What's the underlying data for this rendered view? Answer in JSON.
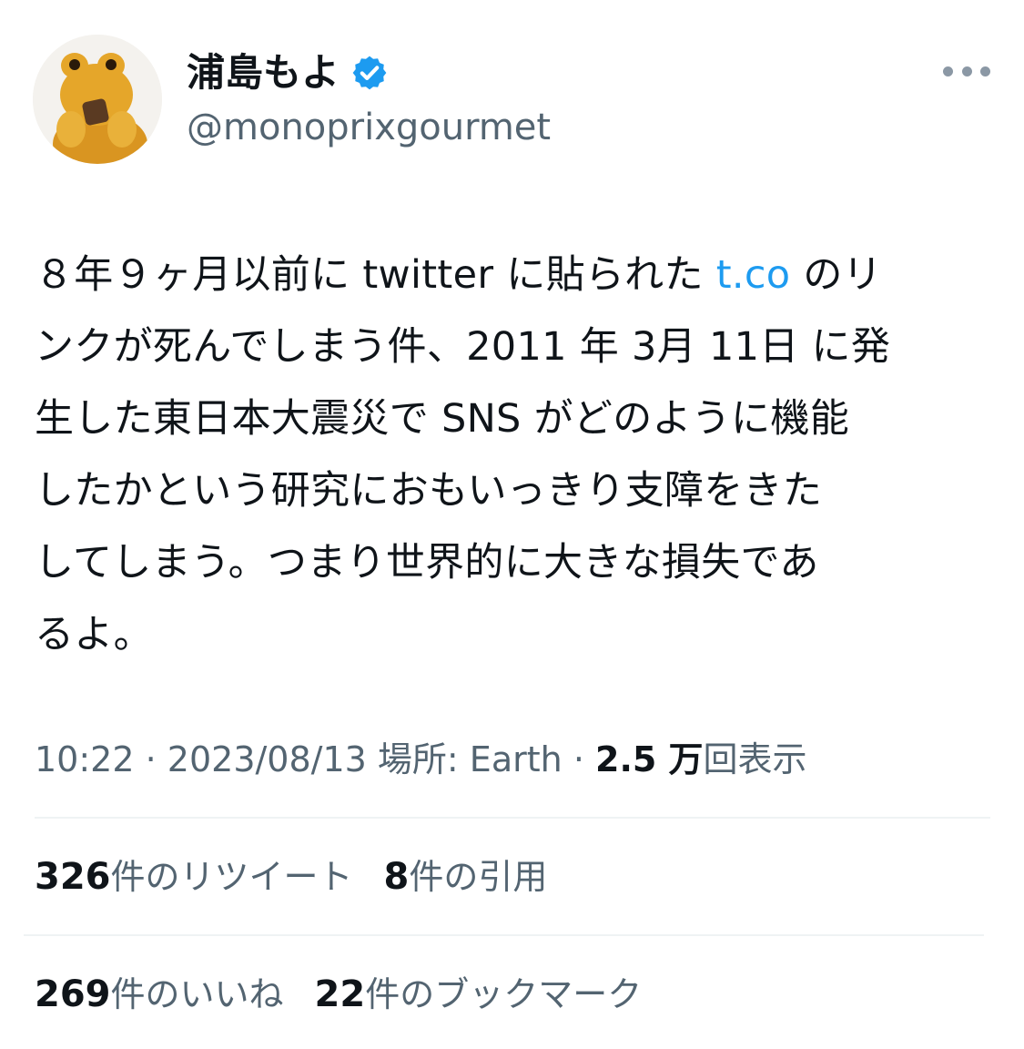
{
  "tweet": {
    "display_name": "浦島もよ",
    "verified_icon": "verified-badge-icon",
    "handle": "@monoprixgourmet",
    "more_icon": "more-options-icon",
    "text": {
      "line1_a": "８年９ヶ月以前に twitter に貼られた ",
      "link": "t.co",
      "line1_b": " のリ",
      "rest": "ンクが死んでしまう件、2011 年 3月 11日 に発\n生した東日本大震災で SNS がどのように機能\nしたかという研究におもいっきり支障をきた\nしてしまう。つまり世界的に大きな損失であ\nるよ。"
    },
    "meta": {
      "time": "10:22",
      "date": "2023/08/13",
      "location_label": "場所: Earth",
      "sep": "·",
      "views_count": "2.5 万",
      "views_label": "回表示"
    },
    "stats": {
      "retweets_count": "326",
      "retweets_label": "件のリツイート",
      "quotes_count": "8",
      "quotes_label": "件の引用",
      "likes_count": "269",
      "likes_label": "件のいいね",
      "bookmarks_count": "22",
      "bookmarks_label": "件のブックマーク"
    }
  },
  "colors": {
    "text": "#0f1419",
    "secondary": "#536471",
    "link": "#1d9bf0",
    "divider": "#eff3f4"
  }
}
